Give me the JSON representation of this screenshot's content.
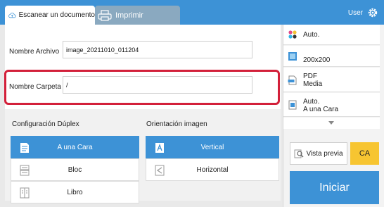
{
  "tabs": {
    "scan_label": "Escanear un documento",
    "print_label": "Imprimir"
  },
  "header": {
    "user_label": "User"
  },
  "form": {
    "file_name_label": "Nombre Archivo",
    "file_name_value": "image_20211010_011204",
    "folder_name_label": "Nombre Carpeta",
    "folder_name_value": "/"
  },
  "duplex": {
    "title": "Configuración Dúplex",
    "options": [
      "A una Cara",
      "Bloc",
      "Libro"
    ],
    "selected": "A una Cara"
  },
  "orientation": {
    "title": "Orientación imagen",
    "options": [
      "Vertical",
      "Horizontal"
    ],
    "selected": "Vertical"
  },
  "sidebar": {
    "color_mode": "Auto.",
    "resolution": "200x200",
    "format_line1": "PDF",
    "format_line2": "Media",
    "scan_size_line1": "Auto.",
    "scan_size_line2": "A una Cara",
    "preview_label": "Vista previa",
    "ca_label": "CA",
    "start_label": "Iniciar"
  },
  "colors": {
    "accent": "#3d92d6",
    "highlight": "#d3203a",
    "ca_button": "#f7c531"
  }
}
